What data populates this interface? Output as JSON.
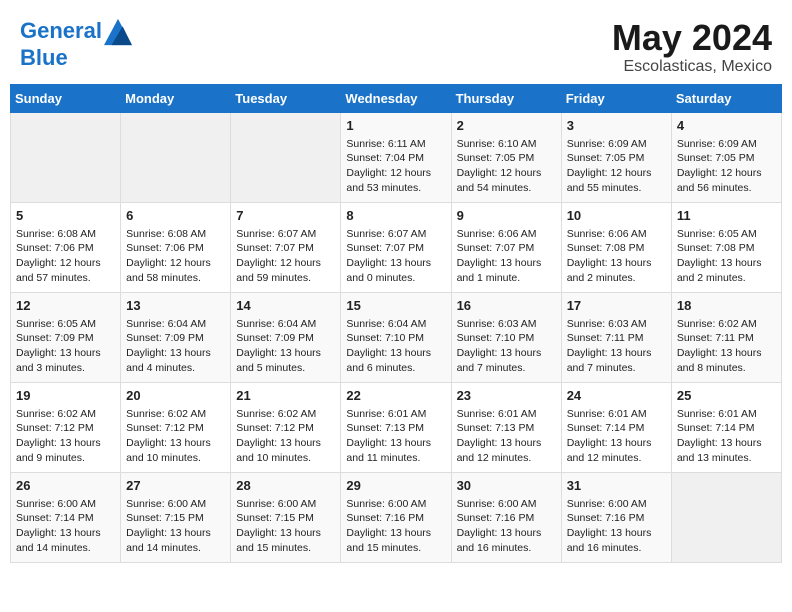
{
  "header": {
    "logo_line1": "General",
    "logo_line2": "Blue",
    "month_year": "May 2024",
    "location": "Escolasticas, Mexico"
  },
  "weekdays": [
    "Sunday",
    "Monday",
    "Tuesday",
    "Wednesday",
    "Thursday",
    "Friday",
    "Saturday"
  ],
  "weeks": [
    [
      {
        "day": "",
        "content": ""
      },
      {
        "day": "",
        "content": ""
      },
      {
        "day": "",
        "content": ""
      },
      {
        "day": "1",
        "content": "Sunrise: 6:11 AM\nSunset: 7:04 PM\nDaylight: 12 hours\nand 53 minutes."
      },
      {
        "day": "2",
        "content": "Sunrise: 6:10 AM\nSunset: 7:05 PM\nDaylight: 12 hours\nand 54 minutes."
      },
      {
        "day": "3",
        "content": "Sunrise: 6:09 AM\nSunset: 7:05 PM\nDaylight: 12 hours\nand 55 minutes."
      },
      {
        "day": "4",
        "content": "Sunrise: 6:09 AM\nSunset: 7:05 PM\nDaylight: 12 hours\nand 56 minutes."
      }
    ],
    [
      {
        "day": "5",
        "content": "Sunrise: 6:08 AM\nSunset: 7:06 PM\nDaylight: 12 hours\nand 57 minutes."
      },
      {
        "day": "6",
        "content": "Sunrise: 6:08 AM\nSunset: 7:06 PM\nDaylight: 12 hours\nand 58 minutes."
      },
      {
        "day": "7",
        "content": "Sunrise: 6:07 AM\nSunset: 7:07 PM\nDaylight: 12 hours\nand 59 minutes."
      },
      {
        "day": "8",
        "content": "Sunrise: 6:07 AM\nSunset: 7:07 PM\nDaylight: 13 hours\nand 0 minutes."
      },
      {
        "day": "9",
        "content": "Sunrise: 6:06 AM\nSunset: 7:07 PM\nDaylight: 13 hours\nand 1 minute."
      },
      {
        "day": "10",
        "content": "Sunrise: 6:06 AM\nSunset: 7:08 PM\nDaylight: 13 hours\nand 2 minutes."
      },
      {
        "day": "11",
        "content": "Sunrise: 6:05 AM\nSunset: 7:08 PM\nDaylight: 13 hours\nand 2 minutes."
      }
    ],
    [
      {
        "day": "12",
        "content": "Sunrise: 6:05 AM\nSunset: 7:09 PM\nDaylight: 13 hours\nand 3 minutes."
      },
      {
        "day": "13",
        "content": "Sunrise: 6:04 AM\nSunset: 7:09 PM\nDaylight: 13 hours\nand 4 minutes."
      },
      {
        "day": "14",
        "content": "Sunrise: 6:04 AM\nSunset: 7:09 PM\nDaylight: 13 hours\nand 5 minutes."
      },
      {
        "day": "15",
        "content": "Sunrise: 6:04 AM\nSunset: 7:10 PM\nDaylight: 13 hours\nand 6 minutes."
      },
      {
        "day": "16",
        "content": "Sunrise: 6:03 AM\nSunset: 7:10 PM\nDaylight: 13 hours\nand 7 minutes."
      },
      {
        "day": "17",
        "content": "Sunrise: 6:03 AM\nSunset: 7:11 PM\nDaylight: 13 hours\nand 7 minutes."
      },
      {
        "day": "18",
        "content": "Sunrise: 6:02 AM\nSunset: 7:11 PM\nDaylight: 13 hours\nand 8 minutes."
      }
    ],
    [
      {
        "day": "19",
        "content": "Sunrise: 6:02 AM\nSunset: 7:12 PM\nDaylight: 13 hours\nand 9 minutes."
      },
      {
        "day": "20",
        "content": "Sunrise: 6:02 AM\nSunset: 7:12 PM\nDaylight: 13 hours\nand 10 minutes."
      },
      {
        "day": "21",
        "content": "Sunrise: 6:02 AM\nSunset: 7:12 PM\nDaylight: 13 hours\nand 10 minutes."
      },
      {
        "day": "22",
        "content": "Sunrise: 6:01 AM\nSunset: 7:13 PM\nDaylight: 13 hours\nand 11 minutes."
      },
      {
        "day": "23",
        "content": "Sunrise: 6:01 AM\nSunset: 7:13 PM\nDaylight: 13 hours\nand 12 minutes."
      },
      {
        "day": "24",
        "content": "Sunrise: 6:01 AM\nSunset: 7:14 PM\nDaylight: 13 hours\nand 12 minutes."
      },
      {
        "day": "25",
        "content": "Sunrise: 6:01 AM\nSunset: 7:14 PM\nDaylight: 13 hours\nand 13 minutes."
      }
    ],
    [
      {
        "day": "26",
        "content": "Sunrise: 6:00 AM\nSunset: 7:14 PM\nDaylight: 13 hours\nand 14 minutes."
      },
      {
        "day": "27",
        "content": "Sunrise: 6:00 AM\nSunset: 7:15 PM\nDaylight: 13 hours\nand 14 minutes."
      },
      {
        "day": "28",
        "content": "Sunrise: 6:00 AM\nSunset: 7:15 PM\nDaylight: 13 hours\nand 15 minutes."
      },
      {
        "day": "29",
        "content": "Sunrise: 6:00 AM\nSunset: 7:16 PM\nDaylight: 13 hours\nand 15 minutes."
      },
      {
        "day": "30",
        "content": "Sunrise: 6:00 AM\nSunset: 7:16 PM\nDaylight: 13 hours\nand 16 minutes."
      },
      {
        "day": "31",
        "content": "Sunrise: 6:00 AM\nSunset: 7:16 PM\nDaylight: 13 hours\nand 16 minutes."
      },
      {
        "day": "",
        "content": ""
      }
    ]
  ]
}
